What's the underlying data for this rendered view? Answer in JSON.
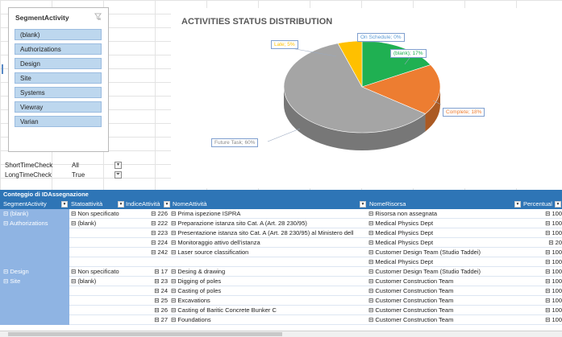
{
  "slicer": {
    "title": "SegmentActivity",
    "items": [
      "(blank)",
      "Authorizations",
      "Design",
      "Site",
      "Systems",
      "Viewray",
      "Varian"
    ]
  },
  "filters": [
    {
      "label": "ShortTimeCheck",
      "value": "All",
      "button": "▾"
    },
    {
      "label": "LongTimeCheck",
      "value": "True",
      "button": "⏷"
    }
  ],
  "chart_data": {
    "type": "pie",
    "title": "ACTIVITIES STATUS DISTRIBUTION",
    "slices": [
      {
        "label": "On Schedule; 0%",
        "value": 0,
        "color": "#5b9bd5"
      },
      {
        "label": "(blank); 17%",
        "value": 17,
        "color": "#1fb052"
      },
      {
        "label": "Complete; 18%",
        "value": 18,
        "color": "#ed7d31"
      },
      {
        "label": "Future Task; 60%",
        "value": 60,
        "color": "#a5a5a5"
      },
      {
        "label": "Late; 5%",
        "value": 5,
        "color": "#ffc000"
      }
    ]
  },
  "pivot": {
    "header_title": "Conteggio di IDAssegnazione",
    "columns": [
      "SegmentActivity",
      "Statoattività",
      "IndiceAttività",
      "NomeAttività",
      "NomeRisorsa",
      "Percentual"
    ],
    "rows": [
      {
        "seg": "⊟ (blank)",
        "stato": "⊟ Non specificato",
        "ind": "⊟ 226",
        "nome": "⊟ Prima ispezione ISPRA",
        "ris": "⊟ Risorsa non assegnata",
        "perc": "⊟ 100"
      },
      {
        "seg": "⊟ Authorizations",
        "stato": "⊟ (blank)",
        "ind": "⊟ 222",
        "nome": "⊟ Preparazione istanza sito Cat. A (Art. 28 230/95)",
        "ris": "⊟ Medical Physics Dept",
        "perc": "⊟ 100"
      },
      {
        "seg": "",
        "stato": "",
        "ind": "⊟ 223",
        "nome": "⊟ Presentazione istanza sito Cat. A (Art. 28 230/95) al Ministero dell",
        "ris": "⊟ Medical Physics Dept",
        "perc": "⊟ 100"
      },
      {
        "seg": "",
        "stato": "",
        "ind": "⊟ 224",
        "nome": "⊟ Monitoraggio attivo dell'istanza",
        "ris": "⊟ Medical Physics Dept",
        "perc": "⊟ 20"
      },
      {
        "seg": "",
        "stato": "",
        "ind": "⊟ 242",
        "nome": "⊟ Laser source classification",
        "ris": "⊟ Customer Design Team (Studio Taddei)",
        "perc": "⊟ 100"
      },
      {
        "seg": "",
        "stato": "",
        "ind": "",
        "nome": "",
        "ris": "⊟ Medical Physics Dept",
        "perc": "⊟ 100"
      },
      {
        "seg": "⊟ Design",
        "stato": "⊟ Non specificato",
        "ind": "⊟ 17",
        "nome": "⊟ Desing & drawing",
        "ris": "⊟ Customer Design Team (Studio Taddei)",
        "perc": "⊟ 100"
      },
      {
        "seg": "⊟ Site",
        "stato": "⊟ (blank)",
        "ind": "⊟ 23",
        "nome": "⊟ Digging of poles",
        "ris": "⊟ Customer Construction Team",
        "perc": "⊟ 100"
      },
      {
        "seg": "",
        "stato": "",
        "ind": "⊟ 24",
        "nome": "⊟ Casting of poles",
        "ris": "⊟ Customer Construction Team",
        "perc": "⊟ 100"
      },
      {
        "seg": "",
        "stato": "",
        "ind": "⊟ 25",
        "nome": "⊟ Excavations",
        "ris": "⊟ Customer Construction Team",
        "perc": "⊟ 100"
      },
      {
        "seg": "",
        "stato": "",
        "ind": "⊟ 26",
        "nome": "⊟ Casting of Baritic Concrete Bunker C",
        "ris": "⊟ Customer Construction Team",
        "perc": "⊟ 100"
      },
      {
        "seg": "",
        "stato": "",
        "ind": "⊟ 27",
        "nome": "⊟ Foundations",
        "ris": "⊟ Customer Construction Team",
        "perc": "⊟ 100"
      }
    ]
  }
}
